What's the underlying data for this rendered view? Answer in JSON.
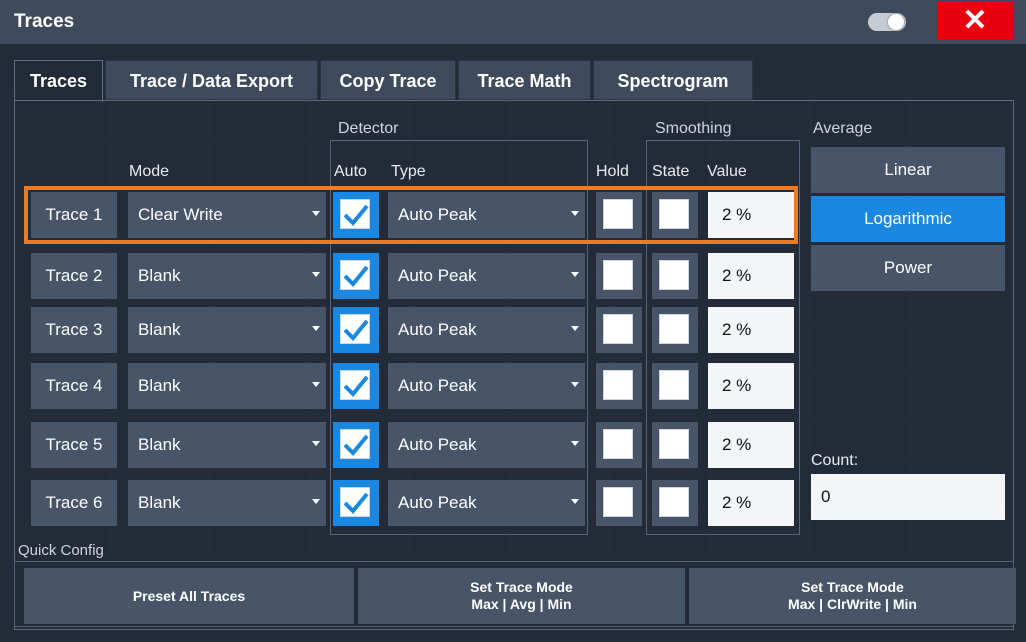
{
  "window": {
    "title": "Traces",
    "toggle_icon": "toggle-switch-icon",
    "close_label": "✕"
  },
  "tabs": [
    {
      "label": "Traces",
      "active": true
    },
    {
      "label": "Trace / Data Export"
    },
    {
      "label": "Copy Trace"
    },
    {
      "label": "Trace Math"
    },
    {
      "label": "Spectrogram"
    }
  ],
  "headers": {
    "detector": "Detector",
    "smoothing": "Smoothing",
    "average": "Average",
    "mode": "Mode",
    "auto": "Auto",
    "type": "Type",
    "hold": "Hold",
    "state": "State",
    "value": "Value"
  },
  "traces": [
    {
      "name": "Trace 1",
      "mode": "Clear Write",
      "auto": true,
      "type": "Auto Peak",
      "hold": false,
      "state": false,
      "value": "2 %"
    },
    {
      "name": "Trace 2",
      "mode": "Blank",
      "auto": true,
      "type": "Auto Peak",
      "hold": false,
      "state": false,
      "value": "2 %"
    },
    {
      "name": "Trace 3",
      "mode": "Blank",
      "auto": true,
      "type": "Auto Peak",
      "hold": false,
      "state": false,
      "value": "2 %"
    },
    {
      "name": "Trace 4",
      "mode": "Blank",
      "auto": true,
      "type": "Auto Peak",
      "hold": false,
      "state": false,
      "value": "2 %"
    },
    {
      "name": "Trace 5",
      "mode": "Blank",
      "auto": true,
      "type": "Auto Peak",
      "hold": false,
      "state": false,
      "value": "2 %"
    },
    {
      "name": "Trace 6",
      "mode": "Blank",
      "auto": true,
      "type": "Auto Peak",
      "hold": false,
      "state": false,
      "value": "2 %"
    }
  ],
  "selected_trace": "Trace 1",
  "average": {
    "options": [
      "Linear",
      "Logarithmic",
      "Power"
    ],
    "selected": "Logarithmic",
    "count_label": "Count:",
    "count_value": "0"
  },
  "quick_config": {
    "title": "Quick Config",
    "buttons": [
      {
        "line1": "Preset All Traces",
        "line2": ""
      },
      {
        "line1": "Set Trace Mode",
        "line2": "Max | Avg | Min"
      },
      {
        "line1": "Set Trace Mode",
        "line2": "Max | ClrWrite | Min"
      }
    ]
  },
  "colors": {
    "accent_blue": "#1a88e0",
    "selection_orange": "#ee7a21",
    "close_red": "#e8000f"
  }
}
